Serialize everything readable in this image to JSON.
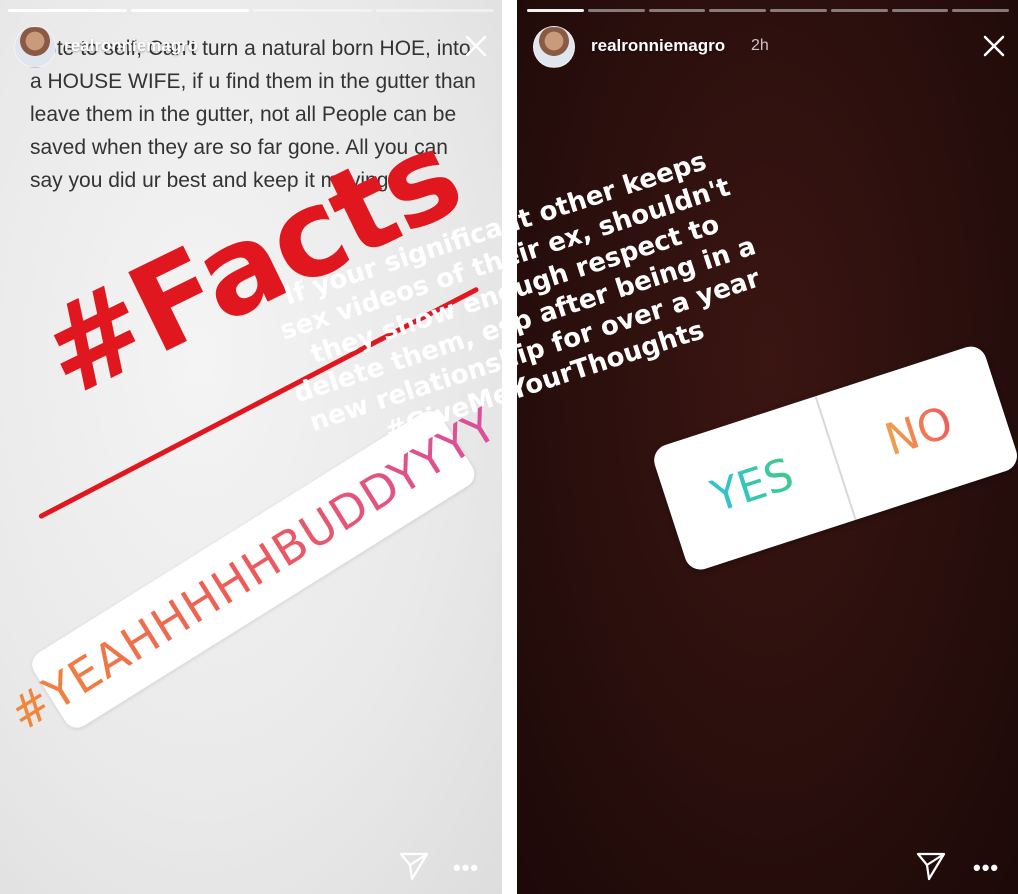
{
  "left_story": {
    "username": "realronniemagro",
    "quote": "Note to self, Can't turn a natural born HOE, into a HOUSE WIFE, if u find them in the gutter than leave them in the gutter, not all People can be saved when they are so far gone. All you can say you did ur best and keep it moving!",
    "facts_text": "#Facts",
    "hashtag_text": "#YEAHHHHHBUDDYYYY",
    "colors": {
      "facts": "#e1171f"
    },
    "icons": {
      "close": "close-icon",
      "share": "send-icon",
      "more": "more-icon"
    },
    "more_glyph": "•••"
  },
  "right_story": {
    "username": "realronniemagro",
    "timestamp": "2h",
    "question": "If your significant other keeps sex videos of their ex, shouldn't they show enough respect to delete them, esp after being in a new relationship for over a year #GiveMeYourThoughts",
    "poll": {
      "yes_label": "YES",
      "no_label": "NO"
    },
    "icons": {
      "close": "close-icon",
      "share": "send-icon",
      "more": "more-icon"
    },
    "more_glyph": "•••"
  }
}
